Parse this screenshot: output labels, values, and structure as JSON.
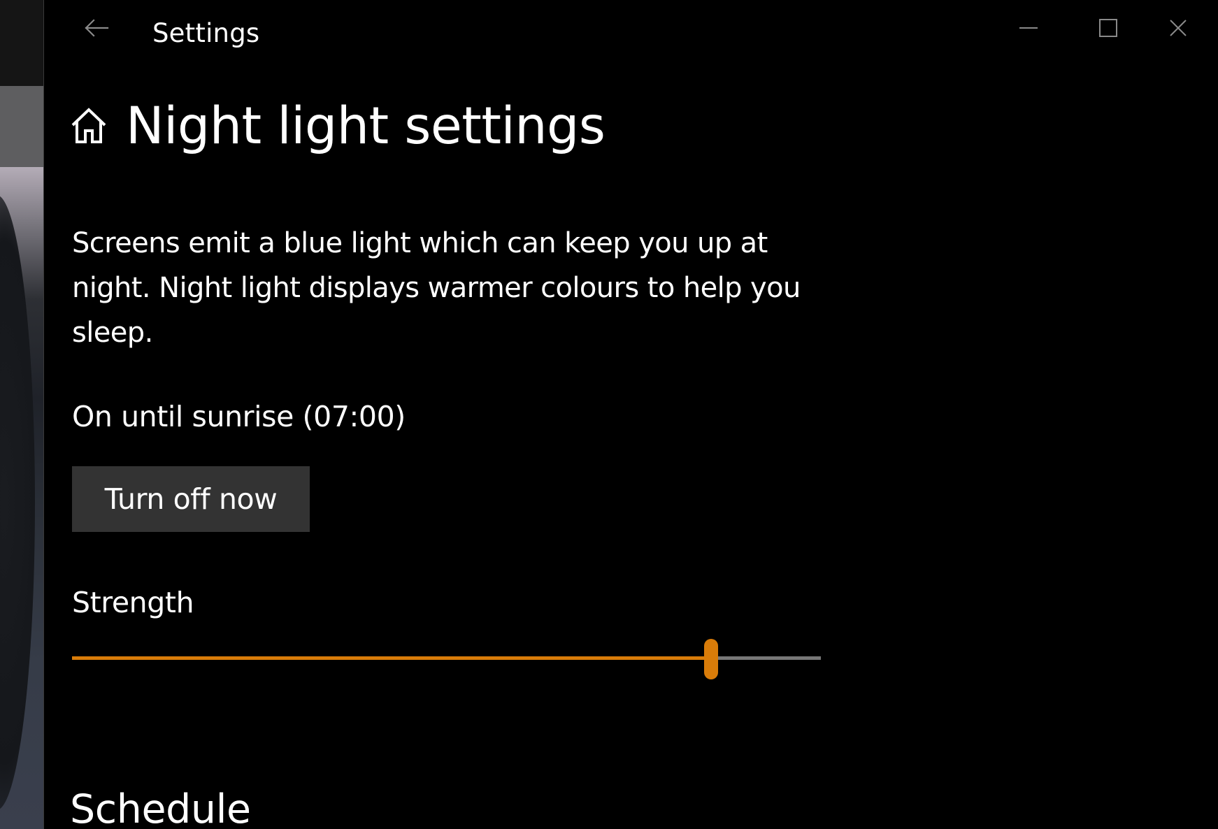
{
  "window": {
    "title": "Settings",
    "controls": {
      "minimize_icon": "minimize-icon",
      "maximize_icon": "maximize-icon",
      "close_icon": "close-icon"
    }
  },
  "page": {
    "title": "Night light settings",
    "description": "Screens emit a blue light which can keep you up at night. Night light displays warmer colours to help you sleep.",
    "status": "On until sunrise (07:00)",
    "turn_off_label": "Turn off now",
    "strength": {
      "label": "Strength",
      "value_fraction": 0.853
    },
    "schedule_heading": "Schedule"
  },
  "colors": {
    "accent": "#d97c09",
    "background": "#000000",
    "button": "#333333",
    "track": "#777777"
  },
  "icons": {
    "back": "back-arrow-icon",
    "home": "home-icon"
  }
}
